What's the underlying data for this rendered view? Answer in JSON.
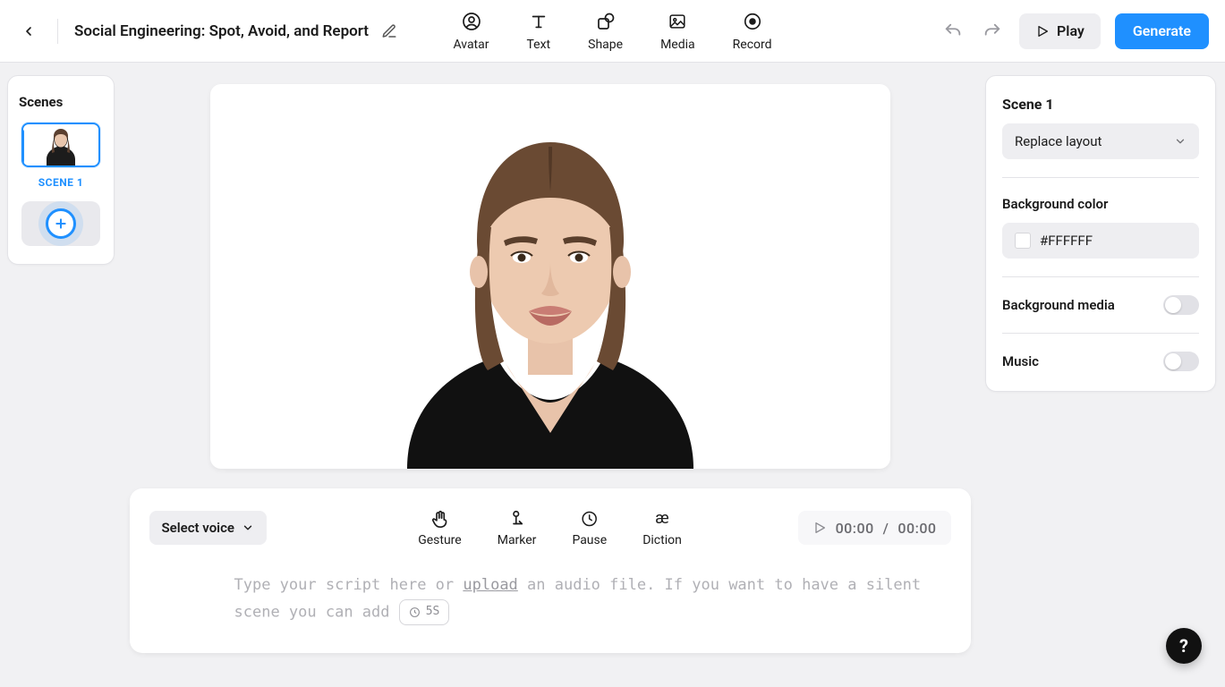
{
  "header": {
    "title": "Social Engineering: Spot, Avoid, and Report",
    "tools": [
      {
        "id": "avatar",
        "label": "Avatar"
      },
      {
        "id": "text",
        "label": "Text"
      },
      {
        "id": "shape",
        "label": "Shape"
      },
      {
        "id": "media",
        "label": "Media"
      },
      {
        "id": "record",
        "label": "Record"
      }
    ],
    "play_label": "Play",
    "generate_label": "Generate"
  },
  "scenes": {
    "title": "Scenes",
    "items": [
      {
        "caption": "SCENE 1",
        "active": true
      }
    ]
  },
  "script": {
    "select_voice_label": "Select voice",
    "tools": [
      {
        "id": "gesture",
        "label": "Gesture"
      },
      {
        "id": "marker",
        "label": "Marker"
      },
      {
        "id": "pause",
        "label": "Pause"
      },
      {
        "id": "diction",
        "label": "Diction"
      }
    ],
    "time_current": "00:00",
    "time_total": "00:00",
    "placeholder_pre": "Type your script here or ",
    "placeholder_link": "upload",
    "placeholder_mid": " an audio file. If you want to have a silent scene you can add ",
    "placeholder_chip": "5S"
  },
  "props": {
    "scene_title": "Scene 1",
    "replace_layout_label": "Replace layout",
    "bg_color_label": "Background color",
    "bg_color_value": "#FFFFFF",
    "bg_media_label": "Background media",
    "bg_media_on": false,
    "music_label": "Music",
    "music_on": false
  },
  "help": {
    "label": "?"
  }
}
